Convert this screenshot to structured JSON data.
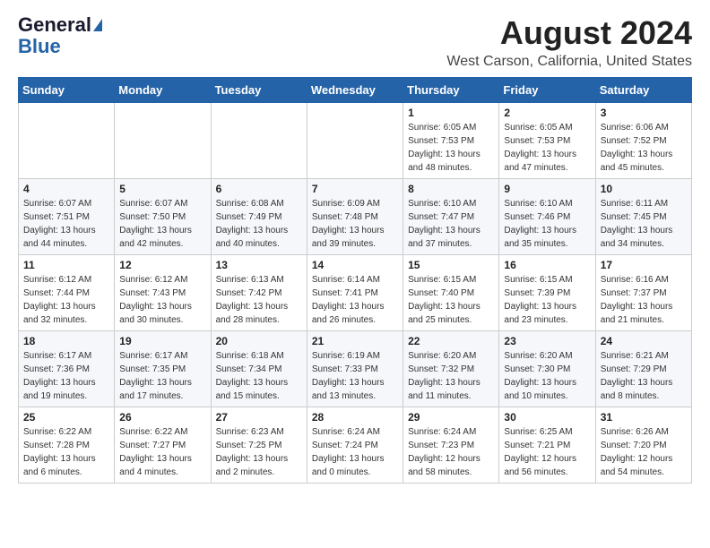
{
  "header": {
    "logo_general": "General",
    "logo_blue": "Blue",
    "month_title": "August 2024",
    "location": "West Carson, California, United States"
  },
  "weekdays": [
    "Sunday",
    "Monday",
    "Tuesday",
    "Wednesday",
    "Thursday",
    "Friday",
    "Saturday"
  ],
  "weeks": [
    [
      {
        "day": "",
        "sunrise": "",
        "sunset": "",
        "daylight": ""
      },
      {
        "day": "",
        "sunrise": "",
        "sunset": "",
        "daylight": ""
      },
      {
        "day": "",
        "sunrise": "",
        "sunset": "",
        "daylight": ""
      },
      {
        "day": "",
        "sunrise": "",
        "sunset": "",
        "daylight": ""
      },
      {
        "day": "1",
        "sunrise": "6:05 AM",
        "sunset": "7:53 PM",
        "daylight": "13 hours and 48 minutes."
      },
      {
        "day": "2",
        "sunrise": "6:05 AM",
        "sunset": "7:53 PM",
        "daylight": "13 hours and 47 minutes."
      },
      {
        "day": "3",
        "sunrise": "6:06 AM",
        "sunset": "7:52 PM",
        "daylight": "13 hours and 45 minutes."
      }
    ],
    [
      {
        "day": "4",
        "sunrise": "6:07 AM",
        "sunset": "7:51 PM",
        "daylight": "13 hours and 44 minutes."
      },
      {
        "day": "5",
        "sunrise": "6:07 AM",
        "sunset": "7:50 PM",
        "daylight": "13 hours and 42 minutes."
      },
      {
        "day": "6",
        "sunrise": "6:08 AM",
        "sunset": "7:49 PM",
        "daylight": "13 hours and 40 minutes."
      },
      {
        "day": "7",
        "sunrise": "6:09 AM",
        "sunset": "7:48 PM",
        "daylight": "13 hours and 39 minutes."
      },
      {
        "day": "8",
        "sunrise": "6:10 AM",
        "sunset": "7:47 PM",
        "daylight": "13 hours and 37 minutes."
      },
      {
        "day": "9",
        "sunrise": "6:10 AM",
        "sunset": "7:46 PM",
        "daylight": "13 hours and 35 minutes."
      },
      {
        "day": "10",
        "sunrise": "6:11 AM",
        "sunset": "7:45 PM",
        "daylight": "13 hours and 34 minutes."
      }
    ],
    [
      {
        "day": "11",
        "sunrise": "6:12 AM",
        "sunset": "7:44 PM",
        "daylight": "13 hours and 32 minutes."
      },
      {
        "day": "12",
        "sunrise": "6:12 AM",
        "sunset": "7:43 PM",
        "daylight": "13 hours and 30 minutes."
      },
      {
        "day": "13",
        "sunrise": "6:13 AM",
        "sunset": "7:42 PM",
        "daylight": "13 hours and 28 minutes."
      },
      {
        "day": "14",
        "sunrise": "6:14 AM",
        "sunset": "7:41 PM",
        "daylight": "13 hours and 26 minutes."
      },
      {
        "day": "15",
        "sunrise": "6:15 AM",
        "sunset": "7:40 PM",
        "daylight": "13 hours and 25 minutes."
      },
      {
        "day": "16",
        "sunrise": "6:15 AM",
        "sunset": "7:39 PM",
        "daylight": "13 hours and 23 minutes."
      },
      {
        "day": "17",
        "sunrise": "6:16 AM",
        "sunset": "7:37 PM",
        "daylight": "13 hours and 21 minutes."
      }
    ],
    [
      {
        "day": "18",
        "sunrise": "6:17 AM",
        "sunset": "7:36 PM",
        "daylight": "13 hours and 19 minutes."
      },
      {
        "day": "19",
        "sunrise": "6:17 AM",
        "sunset": "7:35 PM",
        "daylight": "13 hours and 17 minutes."
      },
      {
        "day": "20",
        "sunrise": "6:18 AM",
        "sunset": "7:34 PM",
        "daylight": "13 hours and 15 minutes."
      },
      {
        "day": "21",
        "sunrise": "6:19 AM",
        "sunset": "7:33 PM",
        "daylight": "13 hours and 13 minutes."
      },
      {
        "day": "22",
        "sunrise": "6:20 AM",
        "sunset": "7:32 PM",
        "daylight": "13 hours and 11 minutes."
      },
      {
        "day": "23",
        "sunrise": "6:20 AM",
        "sunset": "7:30 PM",
        "daylight": "13 hours and 10 minutes."
      },
      {
        "day": "24",
        "sunrise": "6:21 AM",
        "sunset": "7:29 PM",
        "daylight": "13 hours and 8 minutes."
      }
    ],
    [
      {
        "day": "25",
        "sunrise": "6:22 AM",
        "sunset": "7:28 PM",
        "daylight": "13 hours and 6 minutes."
      },
      {
        "day": "26",
        "sunrise": "6:22 AM",
        "sunset": "7:27 PM",
        "daylight": "13 hours and 4 minutes."
      },
      {
        "day": "27",
        "sunrise": "6:23 AM",
        "sunset": "7:25 PM",
        "daylight": "13 hours and 2 minutes."
      },
      {
        "day": "28",
        "sunrise": "6:24 AM",
        "sunset": "7:24 PM",
        "daylight": "13 hours and 0 minutes."
      },
      {
        "day": "29",
        "sunrise": "6:24 AM",
        "sunset": "7:23 PM",
        "daylight": "12 hours and 58 minutes."
      },
      {
        "day": "30",
        "sunrise": "6:25 AM",
        "sunset": "7:21 PM",
        "daylight": "12 hours and 56 minutes."
      },
      {
        "day": "31",
        "sunrise": "6:26 AM",
        "sunset": "7:20 PM",
        "daylight": "12 hours and 54 minutes."
      }
    ]
  ]
}
